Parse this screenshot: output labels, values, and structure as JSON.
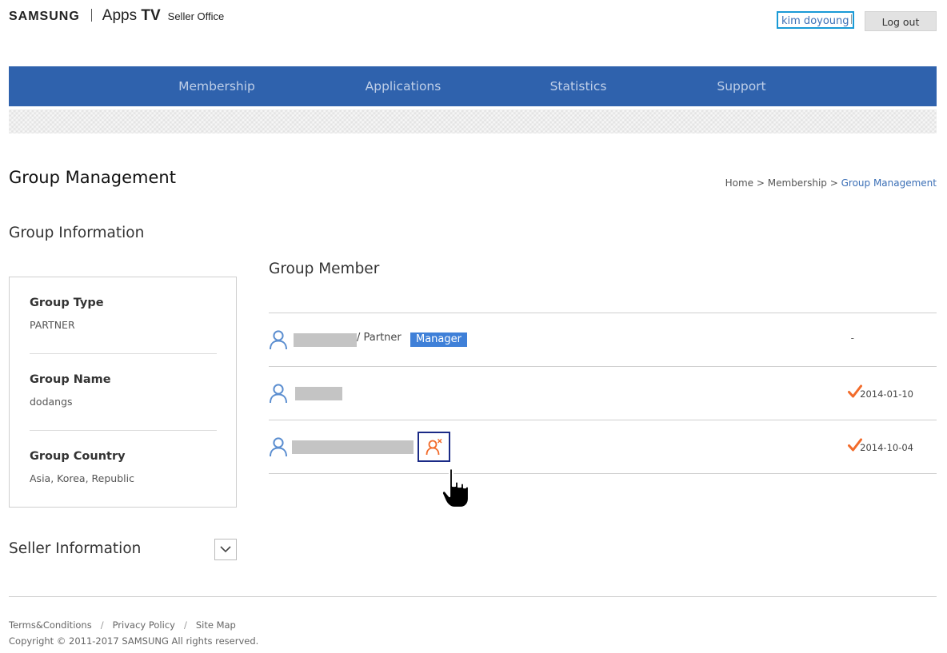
{
  "header": {
    "brand": "SAMSUNG",
    "product_prefix": "Apps ",
    "product_bold": "TV",
    "product_suffix": "Seller Office",
    "user_name": "kim doyoung",
    "logout_label": "Log out"
  },
  "nav": {
    "items": [
      {
        "label": "Membership"
      },
      {
        "label": "Applications"
      },
      {
        "label": "Statistics"
      },
      {
        "label": "Support"
      }
    ]
  },
  "page": {
    "title": "Group Management",
    "breadcrumb": {
      "home": "Home",
      "separator": " > ",
      "parent": "Membership",
      "current": "Group Management"
    }
  },
  "group_info": {
    "title": "Group Information",
    "fields": [
      {
        "label": "Group Type",
        "value": "PARTNER"
      },
      {
        "label": "Group Name",
        "value": "dodangs"
      },
      {
        "label": "Group Country",
        "value": "Asia, Korea, Republic"
      }
    ]
  },
  "seller_info": {
    "title": "Seller Information",
    "toggle_icon": "chevron-down-icon"
  },
  "group_member": {
    "title": "Group Member",
    "members": [
      {
        "role": "/ Partner",
        "badge": "Manager",
        "date": "-",
        "joined_icon": "none",
        "remove_icon": "none"
      },
      {
        "role": "",
        "badge": "",
        "date": "2014-01-10",
        "joined_icon": "check-icon",
        "remove_icon": "none"
      },
      {
        "role": "",
        "badge": "",
        "date": "2014-10-04",
        "joined_icon": "check-icon",
        "remove_icon": "remove-user-icon"
      }
    ]
  },
  "footer": {
    "links": [
      "Terms&Conditions",
      "Privacy Policy",
      "Site Map"
    ],
    "link_separator": "/",
    "copyright": "Copyright © 2011-2017 SAMSUNG All rights reserved."
  },
  "colors": {
    "nav_background": "#2f62ad",
    "nav_text": "#bfcfe8",
    "accent_blue": "#3b6fb6",
    "badge_background": "#3f80d8",
    "check_orange": "#f26b2a",
    "person_icon": "#5b8ed0"
  }
}
